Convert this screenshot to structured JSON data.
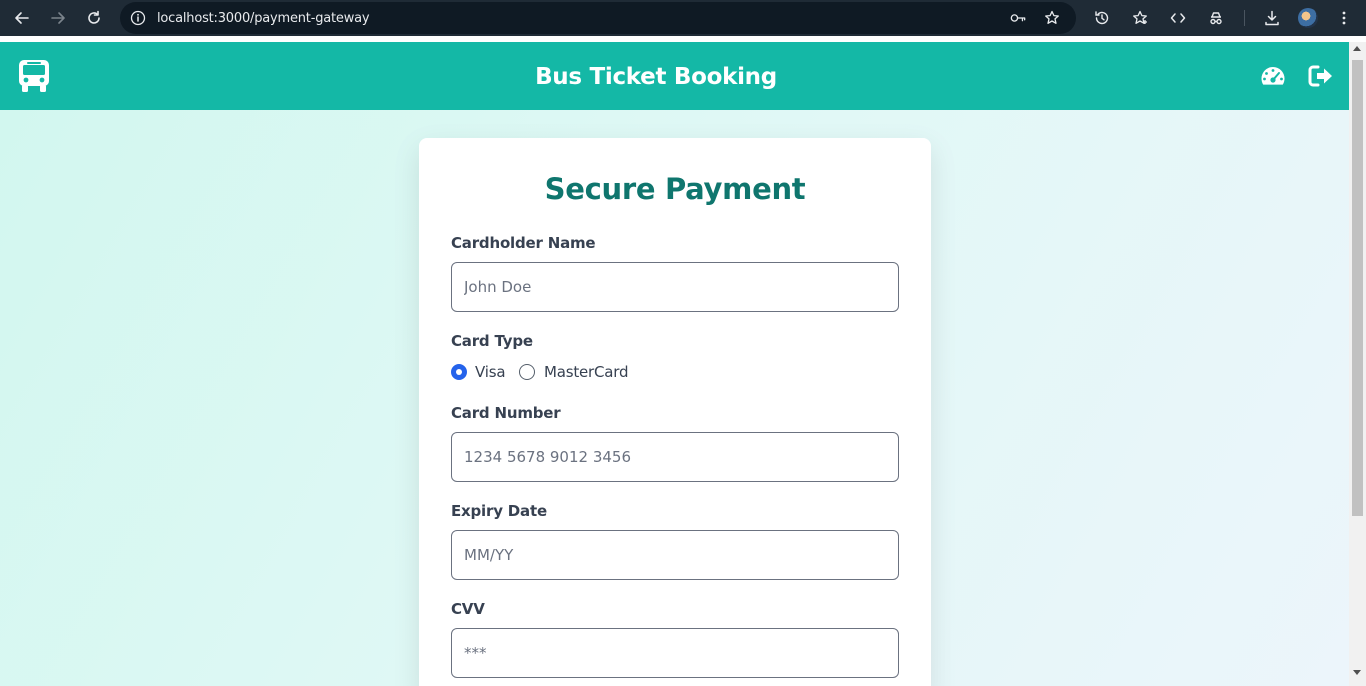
{
  "browser": {
    "url": "localhost:3000/payment-gateway",
    "icons": [
      "back-icon",
      "forward-icon",
      "reload-icon",
      "site-info-icon",
      "password-key-icon",
      "bookmark-star-icon",
      "history-icon",
      "bookmarks-icon",
      "devtools-icon",
      "extensions-icon",
      "download-icon",
      "avatar",
      "menu-icon"
    ]
  },
  "header": {
    "title": "Bus Ticket Booking",
    "logo_icon": "bus-icon",
    "right_icons": [
      "dashboard-icon",
      "logout-icon"
    ],
    "bg_color": "#14b8a6"
  },
  "form": {
    "title": "Secure Payment",
    "cardholder_label": "Cardholder Name",
    "cardholder_placeholder": "John Doe",
    "card_type_label": "Card Type",
    "card_types": [
      {
        "label": "Visa",
        "selected": true
      },
      {
        "label": "MasterCard",
        "selected": false
      }
    ],
    "card_number_label": "Card Number",
    "card_number_placeholder": "1234 5678 9012 3456",
    "expiry_label": "Expiry Date",
    "expiry_placeholder": "MM/YY",
    "cvv_label": "CVV",
    "cvv_placeholder": "***"
  },
  "colors": {
    "title": "#0f766e",
    "radio_selected": "#2563eb"
  }
}
